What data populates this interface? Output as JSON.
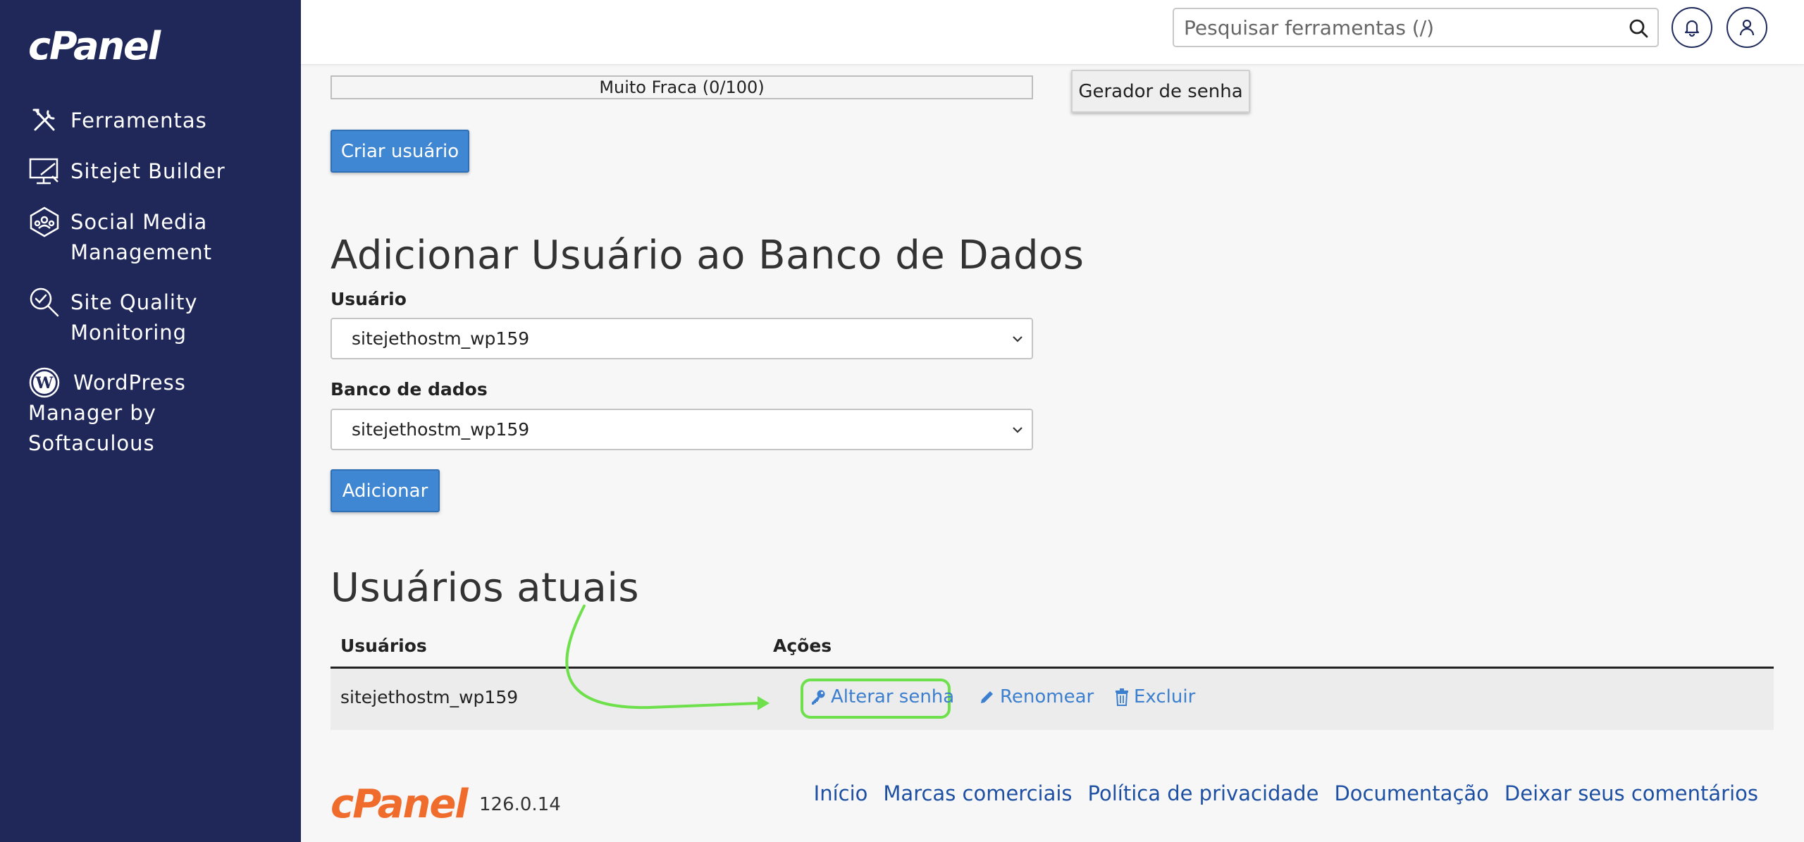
{
  "brand": {
    "logo_text": "cPanel"
  },
  "sidebar": {
    "items": [
      {
        "label": "Ferramentas",
        "icon": "tools-icon"
      },
      {
        "label": "Sitejet Builder",
        "icon": "sitejet-icon"
      },
      {
        "label": "Social Media Management",
        "icon": "social-media-icon"
      },
      {
        "label": "Site Quality Monitoring",
        "icon": "site-quality-icon"
      },
      {
        "label": "WordPress Manager by Softaculous",
        "icon": "wordpress-icon"
      }
    ]
  },
  "header": {
    "search_placeholder": "Pesquisar ferramentas (/)"
  },
  "password": {
    "strength_text": "Muito Fraca (0/100)",
    "strength_value": 0,
    "generator_label": "Gerador de senha",
    "create_label": "Criar usuário"
  },
  "add_user": {
    "title": "Adicionar Usuário ao Banco de Dados",
    "user_label": "Usuário",
    "user_value": "sitejethostm_wp159",
    "db_label": "Banco de dados",
    "db_value": "sitejethostm_wp159",
    "add_label": "Adicionar"
  },
  "current_users": {
    "title": "Usuários atuais",
    "columns": [
      "Usuários",
      "Ações"
    ],
    "rows": [
      {
        "user": "sitejethostm_wp159",
        "actions": [
          "Alterar senha",
          "Renomear",
          "Excluir"
        ]
      }
    ]
  },
  "footer": {
    "logo_text": "cPanel",
    "version": "126.0.14",
    "links": [
      "Início",
      "Marcas comerciais",
      "Política de privacidade",
      "Documentação",
      "Deixar seus comentários"
    ]
  },
  "colors": {
    "sidebar_bg": "#20285a",
    "primary": "#3f87d2",
    "link": "#3d7fcf",
    "highlight": "#6ee04b",
    "footer_logo": "#f06c2d"
  }
}
